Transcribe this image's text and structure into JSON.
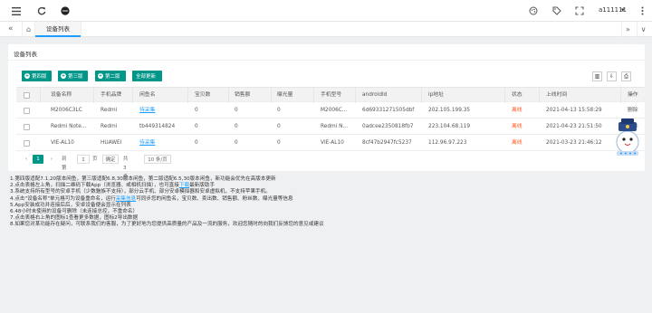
{
  "topbar": {
    "username": "a111111",
    "username_caret": "▾",
    "icons": [
      "menu-icon",
      "refresh-icon",
      "record-icon",
      "theme-icon",
      "tag-icon",
      "expand-icon",
      "more-icon"
    ]
  },
  "tabs": {
    "prev_arrow": "«",
    "home_icon": "⌂",
    "active_label": "设备列表",
    "next_arrow": "»",
    "dropdown_icon": "∨"
  },
  "card": {
    "title": "设备列表",
    "buttons": [
      {
        "label": "第四版"
      },
      {
        "label": "第三版"
      },
      {
        "label": "第二版"
      },
      {
        "label": "全部更新"
      }
    ],
    "tools": {
      "columns": "▥",
      "export": "⇩",
      "print": "⎙"
    }
  },
  "table": {
    "headers": [
      "设备名称",
      "手机品牌",
      "闲鱼名",
      "宝贝数",
      "销售额",
      "曝光量",
      "手机型号",
      "androidId",
      "ip地址",
      "状态",
      "上线时间",
      "操作"
    ],
    "rows": [
      {
        "device": "M2006C3LC",
        "brand": "Redmi",
        "xianyu": "待采集",
        "items": "0",
        "sales": "0",
        "exposure": "0",
        "model": "M2006C...",
        "android_id": "6d69331271505dbf",
        "ip": "202.105.199.35",
        "status": "离线",
        "online_time": "2021-04-13 15:58:29",
        "action": "删除"
      },
      {
        "device": "Redmi Note...",
        "brand": "Redmi",
        "xianyu": "tb449314824",
        "items": "0",
        "sales": "0",
        "exposure": "0",
        "model": "Redmi N...",
        "android_id": "0adcee2350818fb7",
        "ip": "223.104.68.119",
        "status": "离线",
        "online_time": "2021-04-23 21:51:50",
        "action": "删除"
      },
      {
        "device": "VIE-AL10",
        "brand": "HUAWEI",
        "xianyu": "待采集",
        "items": "0",
        "sales": "0",
        "exposure": "0",
        "model": "VIE-AL10",
        "android_id": "8cf47b2947fc5237",
        "ip": "112.96.97.223",
        "status": "离线",
        "online_time": "2021-03-23 21:46:12",
        "action": "删除"
      }
    ]
  },
  "pagination": {
    "prev": "‹",
    "current_page": "1",
    "next": "›",
    "goto_label": "到第",
    "goto_value": "1",
    "page_unit": "页",
    "confirm": "确定",
    "total": "共 3 条",
    "page_size": "10 条/页"
  },
  "notes": {
    "line1": "1.第四版适配7.1,20版本闲鱼，第三版适配6.8,30版本闲鱼，第二版适配6.5,30版本闲鱼，新功能会优先在高版本更新",
    "line2_a": "2.点击表格左上角，扫描二维码下载App（浏览器、或相机扫描），也可直接",
    "line2_link": "下载",
    "line2_b": "最新版助手",
    "line3": "3.系统支持所有型号的安卓手机（少数魅族不支持），部分云手机、部分安卓模拟器和安卓虚拟机，不支持苹果手机。",
    "line4_a": "4.点击\"设备名称\"单元格可为设备重命名，运行",
    "line4_link": "采集信息",
    "line4_b": "可同步您的闲鱼名，宝贝数、卖出数、销售额、粉丝数、曝光量等信息",
    "line5": "5.App安装成功并连接后后，安卓设备便会显示在列表",
    "line6": "6.48小时未使用的设备可删除（未连接总控，不重命名）",
    "line7": "7.点击表格右上角的图标1查看更多数据，图标2导出数据",
    "line8": "8.如果您对某功能存在疑问，可联系我们的客服，为了更好地为您提供高质量的产品及一流的服务，欢迎您随时的向我们反馈您的意见或建议"
  },
  "colors": {
    "primary": "#009688",
    "link": "#1e9fff",
    "offline": "#ff5722",
    "background": "#eef0f2"
  }
}
